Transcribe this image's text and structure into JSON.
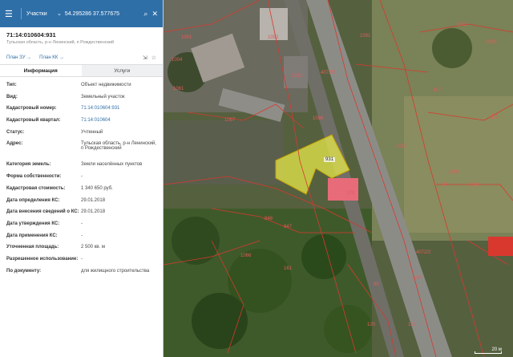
{
  "topbar": {
    "menu_icon": "menu-icon",
    "category": "Участки",
    "search_value": "54.295286 37.577675"
  },
  "parcel": {
    "id": "71:14:010604:931",
    "address": "Тульская область, р-н Ленинский, п Рождественский"
  },
  "links": {
    "plan_zu": "План ЗУ →",
    "plan_kk": "План КК →"
  },
  "tabs": {
    "info": "Информация",
    "services": "Услуги"
  },
  "fields": [
    {
      "key": "Тип:",
      "value": "Объект недвижимости"
    },
    {
      "key": "Вид:",
      "value": "Земельный участок"
    },
    {
      "key": "Кадастровый номер:",
      "value": "71:14:010604:931"
    },
    {
      "key": "Кадастровый квартал:",
      "value": "71:14:010604"
    },
    {
      "key": "Статус:",
      "value": "Учтенный"
    },
    {
      "key": "Адрес:",
      "value": "Тульская область, р-н Ленинский, п Рождественский"
    },
    {
      "key": "Категория земель:",
      "value": "Земли населённых пунктов"
    },
    {
      "key": "Форма собственности:",
      "value": "-"
    },
    {
      "key": "Кадастровая стоимость:",
      "value": "1 340 650 руб."
    },
    {
      "key": "Дата определения КС:",
      "value": "29.01.2018"
    },
    {
      "key": "Дата внесения сведений о КС:",
      "value": "29.01.2018"
    },
    {
      "key": "Дата утверждения КС:",
      "value": "-"
    },
    {
      "key": "Дата применения КС:",
      "value": "-"
    },
    {
      "key": "Уточненная площадь:",
      "value": "2 500 кв. м"
    },
    {
      "key": "Разрешенное использование:",
      "value": "-"
    },
    {
      "key": "По документу:",
      "value": "для жилищного строительства"
    }
  ],
  "map": {
    "parcel_label": "931",
    "labels": [
      "1001",
      "1004",
      "1062",
      "1061",
      "1096",
      "1097",
      "1092",
      "1091",
      "1091",
      "1090",
      "1060",
      "1066",
      "1067",
      "14",
      "417",
      "848",
      "847",
      "161",
      "4072/2",
      "4072/2",
      "123",
      "120",
      "110",
      "95",
      "97",
      "1027",
      "1035",
      "1012"
    ],
    "scale": "20 м",
    "colors": {
      "parcel_fill": "#e5e84a",
      "boundary": "#d9382f",
      "highlight": "#e86b7a"
    }
  }
}
